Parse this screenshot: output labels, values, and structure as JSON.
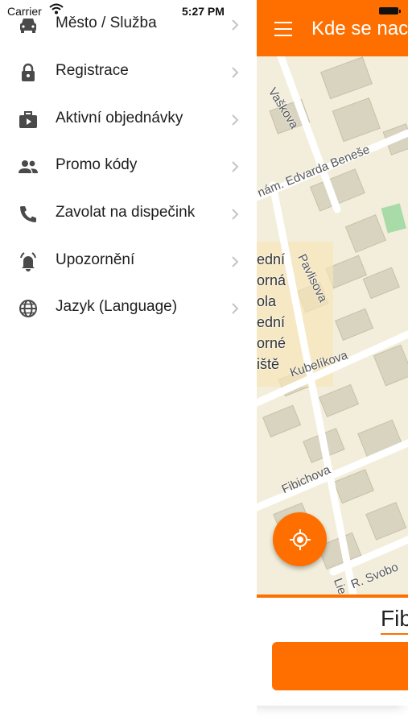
{
  "status_bar": {
    "carrier": "Carrier",
    "time": "5:27 PM"
  },
  "app_bar": {
    "title": "Kde se nac"
  },
  "drawer": {
    "items": [
      {
        "label": "Město / Služba",
        "icon": "car-icon"
      },
      {
        "label": "Registrace",
        "icon": "lock-icon"
      },
      {
        "label": "Aktivní objednávky",
        "icon": "active-orders-icon"
      },
      {
        "label": "Promo kódy",
        "icon": "people-icon"
      },
      {
        "label": "Zavolat na dispečink",
        "icon": "phone-icon"
      },
      {
        "label": "Upozornění",
        "icon": "alarm-bell-icon"
      },
      {
        "label": "Jazyk (Language)",
        "icon": "globe-icon"
      }
    ]
  },
  "map": {
    "street_labels": [
      "Vaškova",
      "nám. Edvarda Beneše",
      "Pavlisova",
      "Kubelíkova",
      "Fibichova",
      "Lie",
      "R. Svobo"
    ],
    "place_label_lines": [
      "ední",
      "orná",
      "ola",
      "ední",
      "orné",
      "iště"
    ]
  },
  "bottom_panel": {
    "address_text": "Fib"
  },
  "colors": {
    "accent": "#ff6f00",
    "map_background": "#f3eedb",
    "icon_gray": "#4a4a4a"
  }
}
